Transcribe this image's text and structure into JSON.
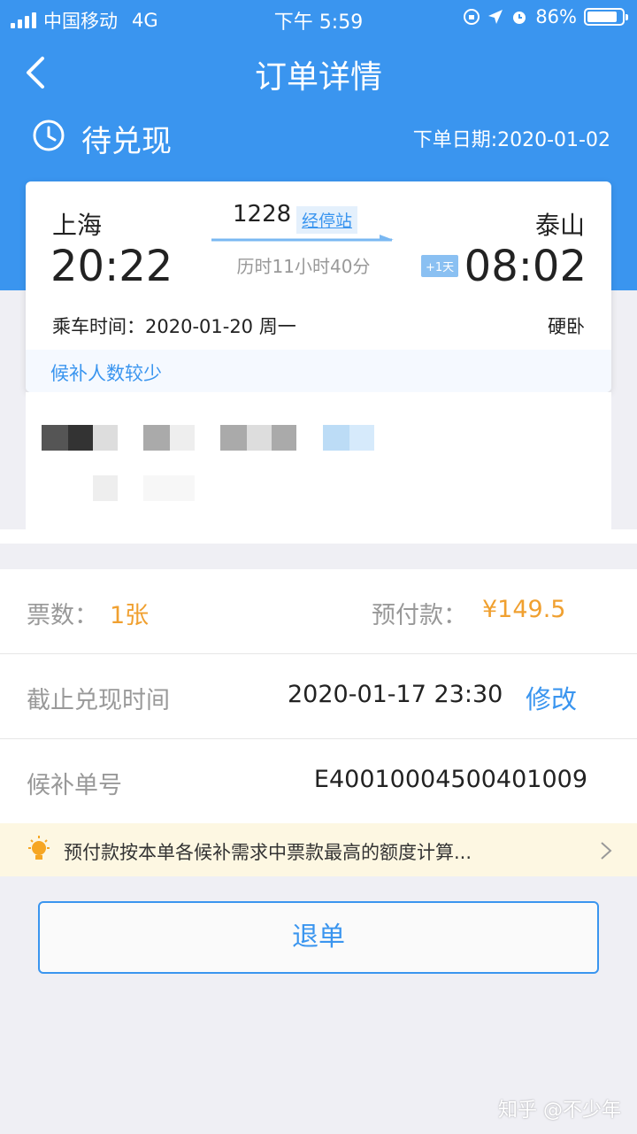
{
  "status_bar": {
    "carrier": "中国移动",
    "network": "4G",
    "time": "下午 5:59",
    "battery": "86%",
    "battery_level": 0.86
  },
  "nav": {
    "title": "订单详情"
  },
  "order_status": {
    "status": "待兑现",
    "order_date": "下单日期:2020-01-02"
  },
  "ticket": {
    "from_city": "上海",
    "to_city": "泰山",
    "departure_time": "20:22",
    "arrival_time": "08:02",
    "train_no": "1228",
    "stops_link": "经停站",
    "duration": "历时11小时40分",
    "next_day_badge": "+1天",
    "ride_date": "乘车时间：2020-01-20 周一",
    "seat_type": "硬卧",
    "notice": "候补人数较少"
  },
  "details": {
    "ticket_count_label": "票数：",
    "ticket_count": "1张",
    "prepay_label": "预付款：",
    "prepay_amount": "¥149.5",
    "deadline_label": "截止兑现时间",
    "deadline_value": "2020-01-17 23:30",
    "modify_label": "修改",
    "order_no_label": "候补单号",
    "order_no": "E400100045004010​09"
  },
  "tip": {
    "text": "预付款按本单各候补需求中票款最高的额度计算..."
  },
  "actions": {
    "refund_label": "退单"
  },
  "watermark": "知乎 @不少年",
  "colors": {
    "primary_blue": "#3a95ef",
    "accent_orange": "#f0a030",
    "tip_background": "#fdf7e2"
  }
}
